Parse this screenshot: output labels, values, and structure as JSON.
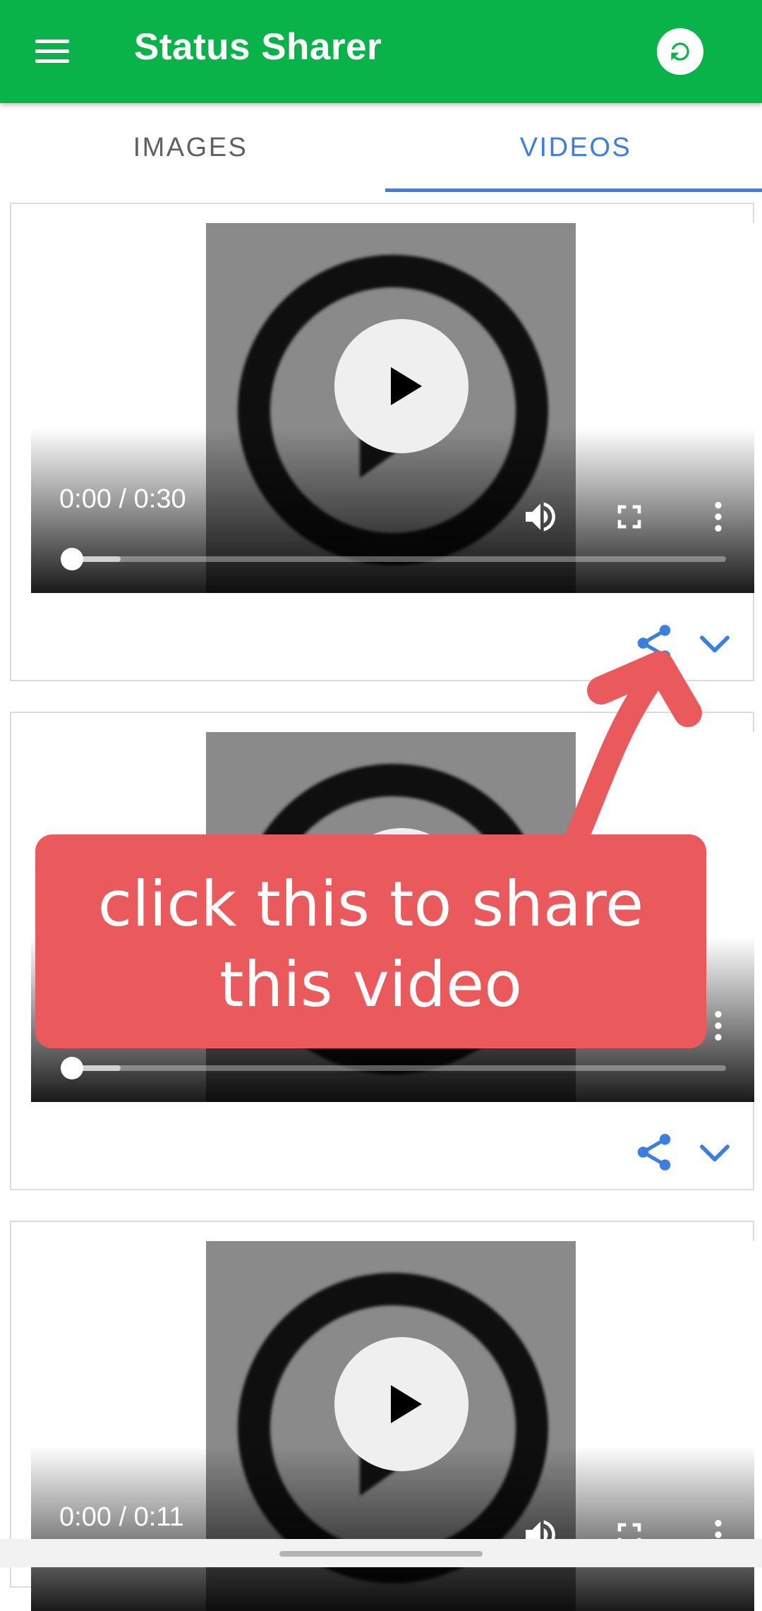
{
  "appbar": {
    "title": "Status Sharer",
    "menu_icon": "hamburger-menu-icon",
    "refresh_icon": "refresh-icon",
    "color": "#0ab34a"
  },
  "tabs": [
    {
      "label": "IMAGES",
      "selected": false
    },
    {
      "label": "VIDEOS",
      "selected": true
    }
  ],
  "accent_color": "#3d7fe0",
  "videos": [
    {
      "time": "0:00 / 0:30",
      "progress": 0.0
    },
    {
      "time": "",
      "progress": 0.0
    },
    {
      "time": "0:00 / 0:11",
      "progress": 0.0
    }
  ],
  "card_actions": {
    "share_icon": "share-icon",
    "expand_icon": "chevron-down-icon"
  },
  "video_controls": {
    "play_icon": "play-icon",
    "volume_icon": "volume-icon",
    "fullscreen_icon": "fullscreen-icon",
    "more_icon": "more-vert-icon"
  },
  "callout": {
    "line1": "click this to share",
    "line2": "this video",
    "color": "#ea5a5c"
  }
}
